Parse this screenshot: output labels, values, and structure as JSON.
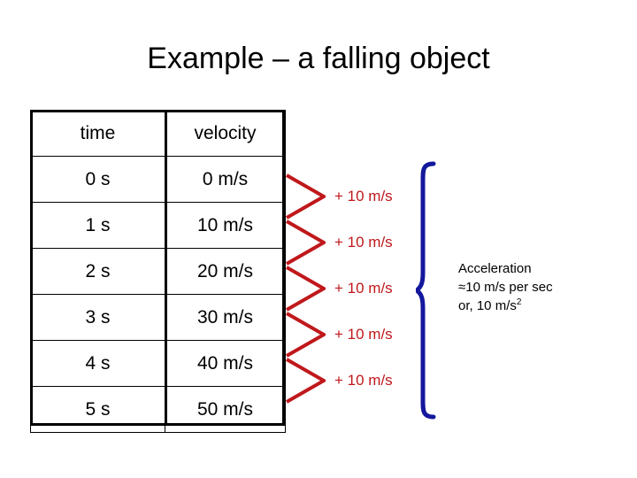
{
  "slide": {
    "title": "Example – a falling object",
    "colors": {
      "text": "#000000",
      "delta_red": "#C0181B",
      "brace_blue": "#14189C",
      "background": "#FFFFFF"
    }
  },
  "table": {
    "headers": [
      "time",
      "velocity"
    ],
    "rows": [
      {
        "time": "0 s",
        "velocity": "0 m/s"
      },
      {
        "time": "1 s",
        "velocity": "10 m/s"
      },
      {
        "time": "2 s",
        "velocity": "20 m/s"
      },
      {
        "time": "3 s",
        "velocity": "30 m/s"
      },
      {
        "time": "4 s",
        "velocity": "40 m/s"
      },
      {
        "time": "5 s",
        "velocity": "50 m/s"
      }
    ]
  },
  "deltas": [
    {
      "label": "+ 10 m/s"
    },
    {
      "label": "+ 10 m/s"
    },
    {
      "label": "+ 10 m/s"
    },
    {
      "label": "+ 10 m/s"
    },
    {
      "label": "+ 10 m/s"
    }
  ],
  "acceleration_note": {
    "line1": "Acceleration",
    "line2": " ≈10 m/s per sec",
    "line3_prefix": "or, 10 m/s",
    "line3_sup": "2"
  },
  "chart_data": {
    "type": "table",
    "title": "Example – a falling object",
    "columns": [
      "time",
      "velocity"
    ],
    "x": [
      0,
      1,
      2,
      3,
      4,
      5
    ],
    "xlabel": "time (s)",
    "ylabel": "velocity (m/s)",
    "series": [
      {
        "name": "velocity",
        "values": [
          0,
          10,
          20,
          30,
          40,
          50
        ],
        "units": "m/s"
      }
    ],
    "annotations": [
      "+ 10 m/s",
      "+ 10 m/s",
      "+ 10 m/s",
      "+ 10 m/s",
      "+ 10 m/s",
      "Acceleration ≈10 m/s per sec or, 10 m/s2"
    ]
  }
}
